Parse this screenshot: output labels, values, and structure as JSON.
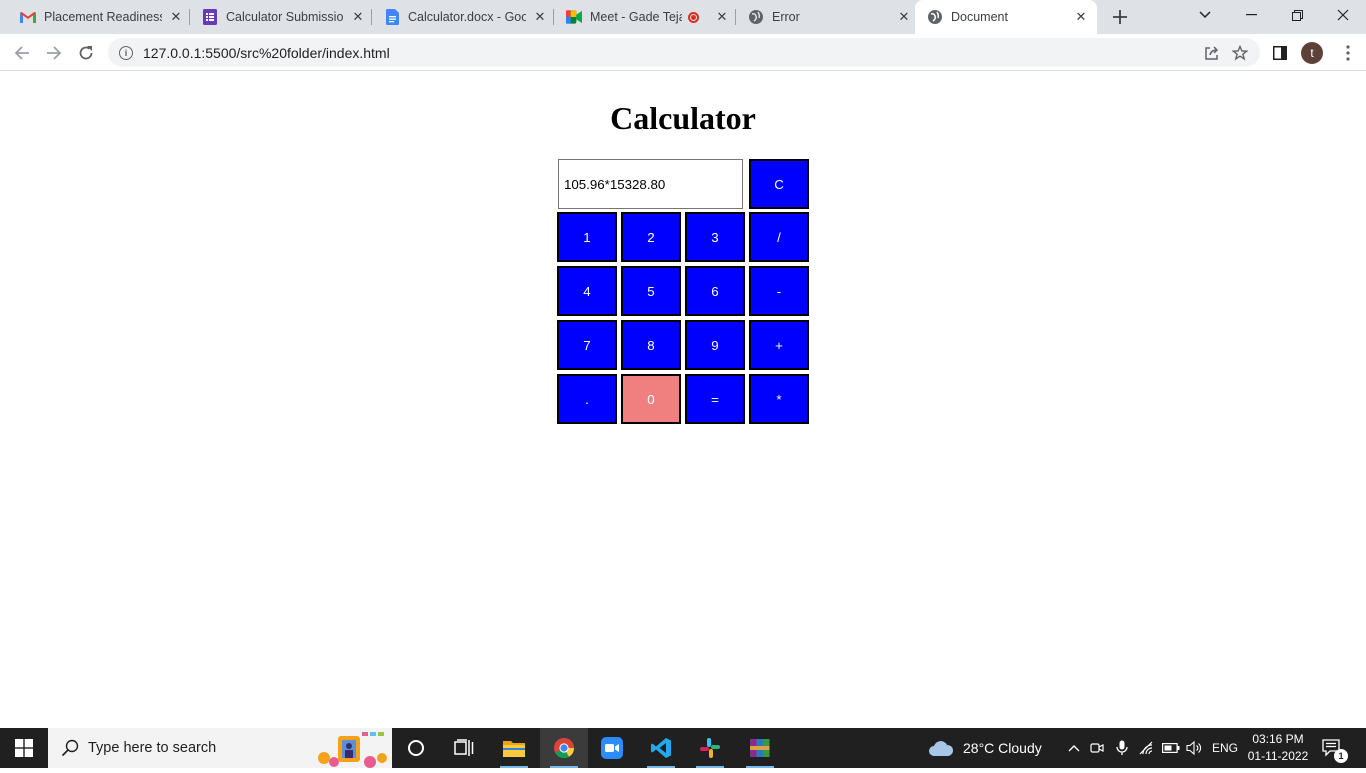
{
  "browser": {
    "tabs": [
      {
        "title": "Placement Readiness T",
        "icon": "gmail-icon"
      },
      {
        "title": "Calculator Submission",
        "icon": "forms-icon"
      },
      {
        "title": "Calculator.docx - Goo",
        "icon": "docs-icon"
      },
      {
        "title": "Meet - Gade Teja",
        "icon": "meet-icon"
      },
      {
        "title": "Error",
        "icon": "globe-icon"
      },
      {
        "title": "Document",
        "icon": "globe-icon",
        "active": true
      }
    ],
    "url": "127.0.0.1:5500/src%20folder/index.html",
    "profile_initial": "t"
  },
  "calculator": {
    "title": "Calculator",
    "display_value": "105.96*15328.80",
    "clear_label": "C",
    "keys": [
      "1",
      "2",
      "3",
      "/",
      "4",
      "5",
      "6",
      "-",
      "7",
      "8",
      "9",
      "+",
      ".",
      "0",
      "=",
      "*"
    ],
    "colors": {
      "key": "#0000ff",
      "highlight": "#f08080"
    }
  },
  "taskbar": {
    "search_placeholder": "Type here to search",
    "weather": "28°C  Cloudy",
    "language": "ENG",
    "time": "03:16 PM",
    "date": "01-11-2022",
    "notification_count": "1"
  }
}
